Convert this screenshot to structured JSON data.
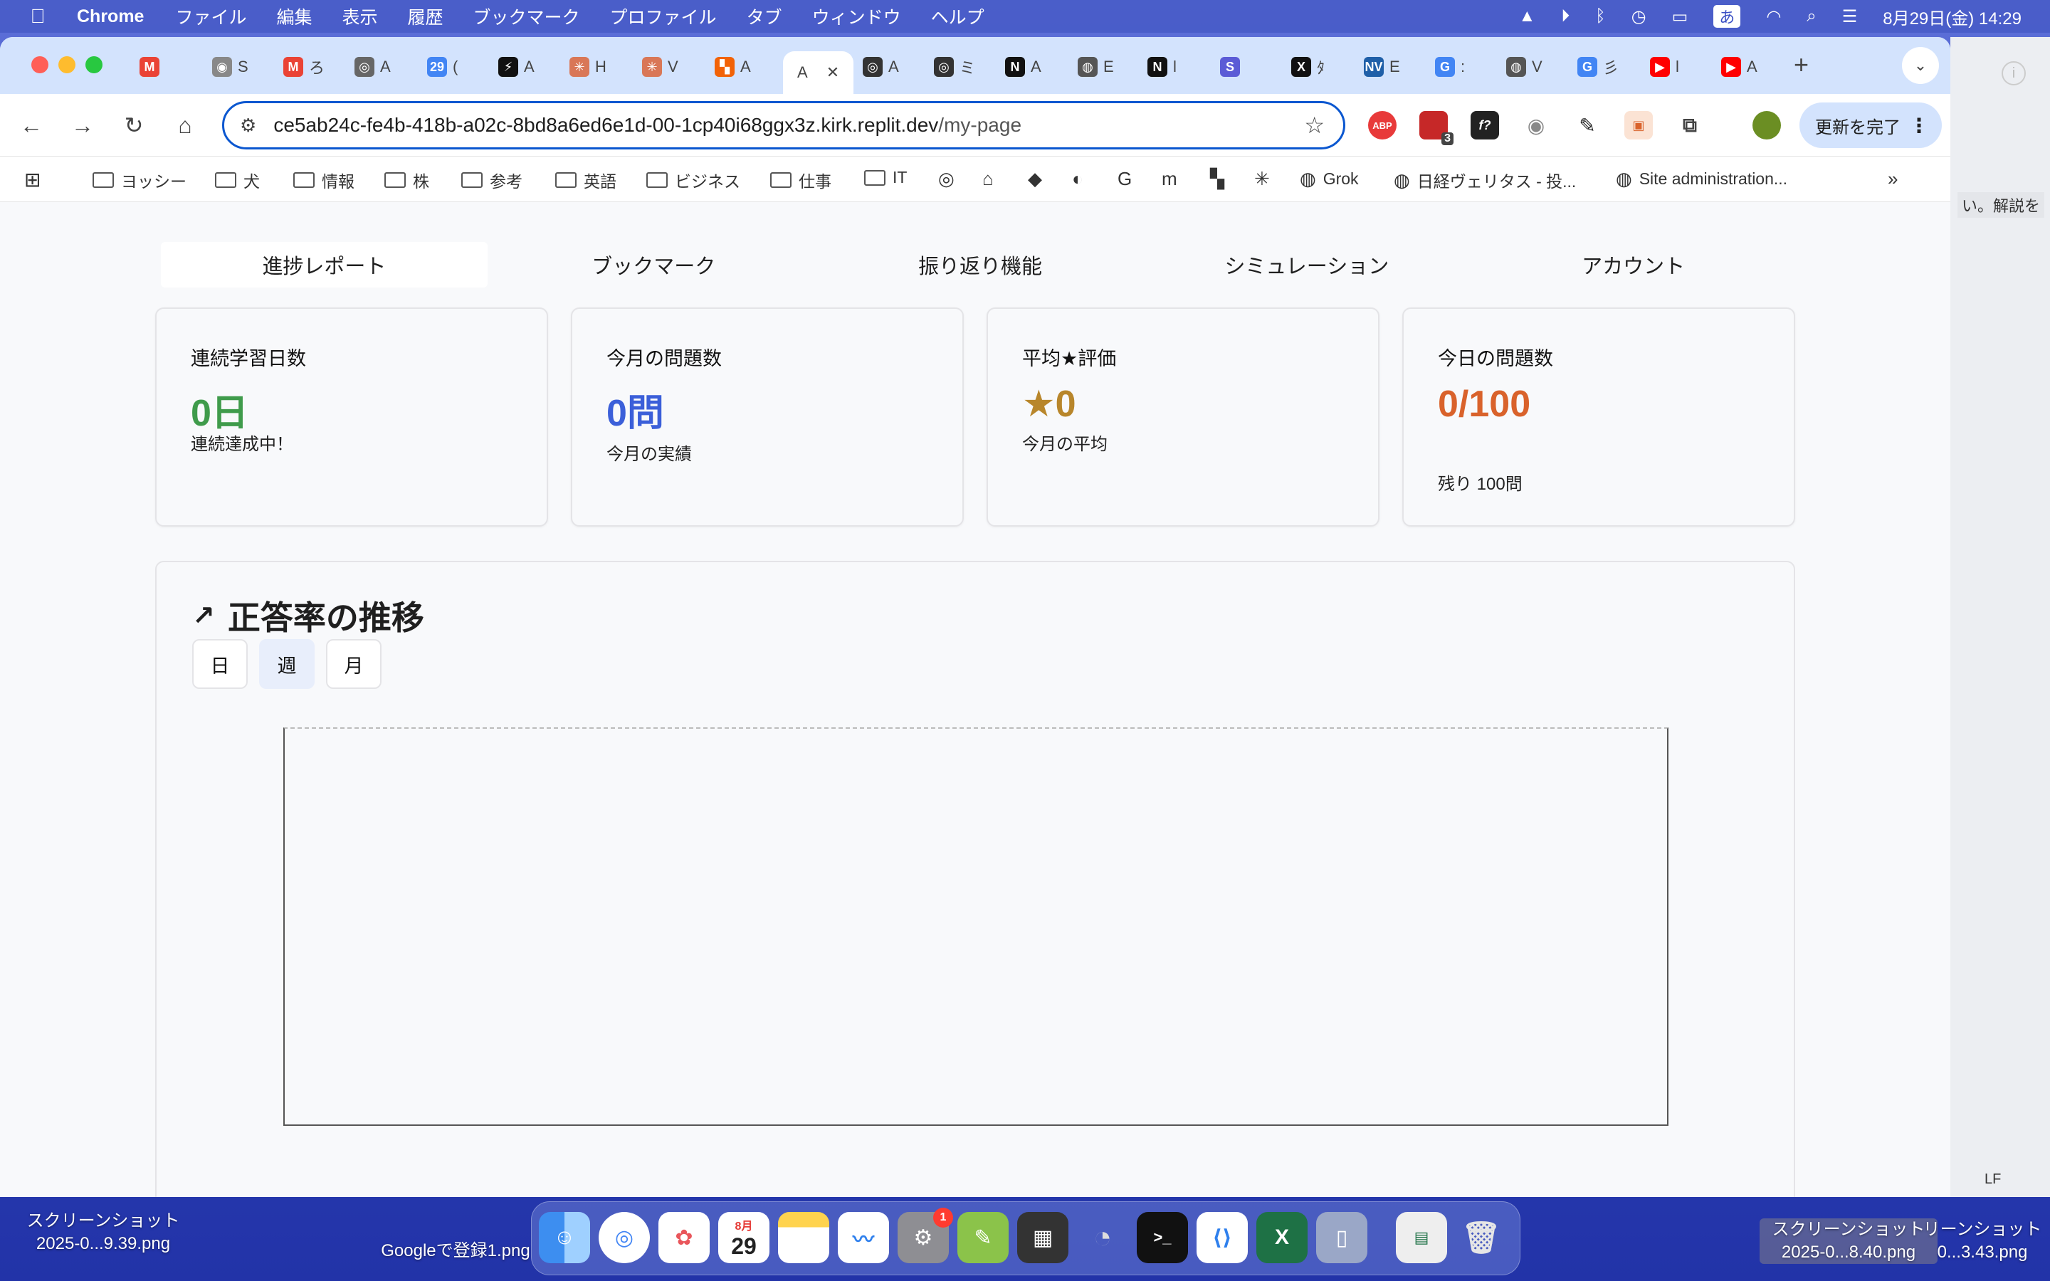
{
  "menubar": {
    "app": "Chrome",
    "items": [
      "ファイル",
      "編集",
      "表示",
      "履歴",
      "ブックマーク",
      "プロファイル",
      "タブ",
      "ウィンドウ",
      "ヘルプ"
    ],
    "input_mode": "あ",
    "datetime": "8月29日(金)  14:29"
  },
  "browser": {
    "url_host": "ce5ab24c-fe4b-418b-a02c-8bd8a6ed6e1d-00-1cp40i68ggx3z.kirk.replit.dev",
    "url_path": "/my-page",
    "update_label": "更新を完了",
    "ext_badge": "3",
    "tabs": [
      {
        "icon": "gmail-icon",
        "label": "",
        "color": "#ea4335",
        "glyph": "M"
      },
      {
        "icon": "camera-icon",
        "label": "S",
        "color": "#888",
        "glyph": "◉"
      },
      {
        "icon": "gmail-icon",
        "label": "ろ",
        "color": "#ea4335",
        "glyph": "M"
      },
      {
        "icon": "openai-icon",
        "label": "A",
        "color": "#666",
        "glyph": "◎"
      },
      {
        "icon": "calendar-icon",
        "label": "(",
        "color": "#4285f4",
        "glyph": "29"
      },
      {
        "icon": "bolt-icon",
        "label": "A",
        "color": "#111",
        "glyph": "⚡"
      },
      {
        "icon": "claude-icon",
        "label": "H",
        "color": "#d97757",
        "glyph": "✳"
      },
      {
        "icon": "claude-icon",
        "label": "V",
        "color": "#d97757",
        "glyph": "✳"
      },
      {
        "icon": "replit-icon",
        "label": "A",
        "color": "#f26207",
        "glyph": "▚"
      },
      {
        "icon": "active-tab",
        "label": "A",
        "color": "#fff",
        "glyph": ""
      },
      {
        "icon": "openai-icon",
        "label": "A",
        "color": "#333",
        "glyph": "◎"
      },
      {
        "icon": "openai-icon",
        "label": "ミ",
        "color": "#333",
        "glyph": "◎"
      },
      {
        "icon": "notion-icon",
        "label": "A",
        "color": "#111",
        "glyph": "N"
      },
      {
        "icon": "globe-icon",
        "label": "E",
        "color": "#555",
        "glyph": "◍"
      },
      {
        "icon": "notion-icon",
        "label": "l",
        "color": "#111",
        "glyph": "N"
      },
      {
        "icon": "s-icon",
        "label": "",
        "color": "#5b5bd6",
        "glyph": "S"
      },
      {
        "icon": "x-icon",
        "label": "ﾀ",
        "color": "#111",
        "glyph": "X"
      },
      {
        "icon": "nv-icon",
        "label": "E",
        "color": "#1f5fa8",
        "glyph": "NV"
      },
      {
        "icon": "google-icon",
        "label": ":",
        "color": "#4285f4",
        "glyph": "G"
      },
      {
        "icon": "globe-icon",
        "label": "V",
        "color": "#555",
        "glyph": "◍"
      },
      {
        "icon": "google-icon",
        "label": "彡",
        "color": "#4285f4",
        "glyph": "G"
      },
      {
        "icon": "youtube-icon",
        "label": "l",
        "color": "#ff0000",
        "glyph": "▶"
      },
      {
        "icon": "youtube-icon",
        "label": "A",
        "color": "#ff0000",
        "glyph": "▶"
      }
    ],
    "bookmarks": [
      {
        "label": "ヨッシー",
        "type": "folder"
      },
      {
        "label": "犬",
        "type": "folder"
      },
      {
        "label": "情報",
        "type": "folder"
      },
      {
        "label": "株",
        "type": "folder"
      },
      {
        "label": "参考",
        "type": "folder"
      },
      {
        "label": "英語",
        "type": "folder"
      },
      {
        "label": "ビジネス",
        "type": "folder"
      },
      {
        "label": "仕事",
        "type": "folder"
      },
      {
        "label": "IT",
        "type": "folder"
      },
      {
        "label": "Grok",
        "type": "link"
      },
      {
        "label": "日経ヴェリタス - 投...",
        "type": "link"
      },
      {
        "label": "Site administration...",
        "type": "link"
      }
    ]
  },
  "page": {
    "nav_tabs": [
      "進捗レポート",
      "ブックマーク",
      "振り返り機能",
      "シミュレーション",
      "アカウント"
    ],
    "active_tab": 0,
    "cards": [
      {
        "title": "連続学習日数",
        "value": "0日",
        "sub": "連続達成中！",
        "color": "#3f9b4b"
      },
      {
        "title": "今月の問題数",
        "value": "0問",
        "sub": "今月の実績",
        "color": "#3b5fd9"
      },
      {
        "title": "平均★評価",
        "value": "★0",
        "sub": "今月の平均",
        "color": "#b8862b"
      },
      {
        "title": "今日の問題数",
        "value": "0/100",
        "sub": "残り 100問",
        "color": "#d9622b"
      }
    ],
    "chart": {
      "title": "正答率の推移",
      "ranges": [
        "日",
        "週",
        "月"
      ],
      "active_range": 1
    }
  },
  "desktop": {
    "file1": "スクリーンショット\n2025-0...9.39.png",
    "file2": "Googleで登録1.png",
    "file3": "スクリーンショット\n2025-0...8.40.png",
    "file4": "リーンショット\n0...3.43.png",
    "side_text": "い。解説を",
    "status_lf": "LF"
  },
  "dock": {
    "calendar_month": "8月",
    "calendar_day": "29",
    "settings_badge": "1"
  }
}
